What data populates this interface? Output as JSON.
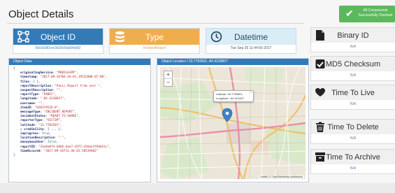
{
  "page": {
    "title": "Object Details"
  },
  "badge": {
    "text": "All Components Successfully Checked",
    "icon": "check-icon",
    "color": "#5cb85c"
  },
  "cards": [
    {
      "label": "Object ID",
      "value": "5bcb3d81ee3b26e5da64ddf2",
      "icon": "network-icon"
    },
    {
      "label": "Type",
      "value": "IncidentReport",
      "icon": "database-icon"
    },
    {
      "label": "Datetime",
      "value": "Tue Sep 26 11:44:00 2017",
      "icon": "clock-icon"
    }
  ],
  "object_data": {
    "title": "Object Data",
    "lines": [
      {
        "t": "p",
        "text": "{"
      },
      {
        "t": "kv",
        "k": "originatingService",
        "v": "\"MOBILEAPP\","
      },
      {
        "t": "kv",
        "k": "timestamp",
        "v": "\"2017-09-26T04:44:01.195Z2000-07:00\","
      },
      {
        "t": "kv",
        "k": "files",
        "v": "[ ],"
      },
      {
        "t": "kv",
        "k": "reportDescription",
        "v": "\"Panic Report from user \","
      },
      {
        "t": "kv",
        "k": "suspectDescription",
        "v": "\"\","
      },
      {
        "t": "kv",
        "k": "reportType",
        "v": "\"PANIC\","
      },
      {
        "t": "kv",
        "k": "longitude",
        "v": "\"-84.4218827\","
      },
      {
        "t": "kv",
        "k": "username",
        "v": "\"\","
      },
      {
        "t": "kv",
        "k": "itemID",
        "v": "\"020379526-8\","
      },
      {
        "t": "kv",
        "k": "messageType",
        "v": "\"INCIDENT_REPORT\","
      },
      {
        "t": "kv",
        "k": "incidentStatus",
        "v": "\"READY_TO_SHARE\","
      },
      {
        "t": "kv",
        "k": "reporterType",
        "v": "\"VICTIM\","
      },
      {
        "t": "kv",
        "k": "latitude",
        "v": "\"33.7783501\","
      },
      {
        "t": "kv",
        "k": "▸ credibility",
        "v": "{ ... },"
      },
      {
        "t": "kv",
        "k": "inprogress",
        "v": "true,"
      },
      {
        "t": "kv",
        "k": "locationDescription",
        "v": "\"-\","
      },
      {
        "t": "kv",
        "k": "anonymousUser",
        "v": "false,"
      },
      {
        "t": "kv",
        "k": "reportID",
        "v": "\"31e0a0f4-b8d6-4ae7-a5f5-41bbe3f9db41c\","
      },
      {
        "t": "kv",
        "k": "timeOccured",
        "v": "\"2017-09-26T11:44:01.58539402\""
      },
      {
        "t": "p",
        "text": "}"
      }
    ]
  },
  "map_panel": {
    "title": "Object Location / 33.7783501,-84.4218827",
    "zoom_in": "+",
    "zoom_out": "−",
    "popup_lat": "Latitude: 33.7783501",
    "popup_lon": "Longitude: -84.421827",
    "popup_close": "×",
    "attribution": "Leaflet | © OpenStreetMap contributors"
  },
  "side": [
    {
      "label": "Binary ID",
      "value": "N/A",
      "icon": "file-icon"
    },
    {
      "label": "MD5 Checksum",
      "value": "N/A",
      "icon": "checkbox-icon"
    },
    {
      "label": "Time To Live",
      "value": "N/A",
      "icon": "heart-icon"
    },
    {
      "label": "Time To Delete",
      "value": "N/A",
      "icon": "trash-icon"
    },
    {
      "label": "Time To Archive",
      "value": "N/A",
      "icon": "archive-icon"
    }
  ]
}
